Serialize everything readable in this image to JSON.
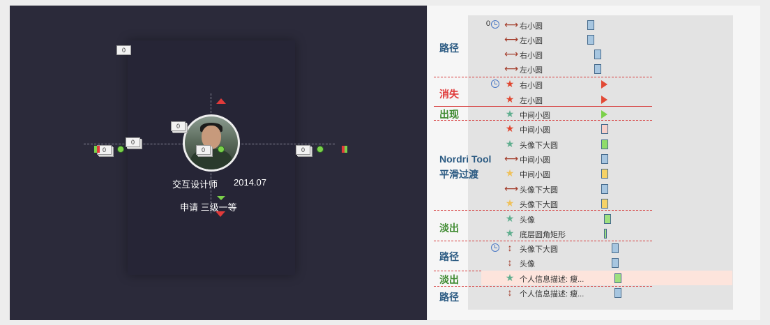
{
  "stage": {
    "name": "交互设计师",
    "date": "2014.07",
    "desc": "申请 三级一等",
    "tags": [
      "0",
      "0",
      "0",
      "0",
      "0",
      "0"
    ]
  },
  "timeline": {
    "groups": [
      {
        "label": "路径"
      },
      {
        "label": "消失"
      },
      {
        "label": "出现"
      },
      {
        "label": "Nordri Tool"
      },
      {
        "label": "平滑过渡"
      },
      {
        "label": "淡出"
      },
      {
        "label": "路径"
      },
      {
        "label": "淡出"
      },
      {
        "label": "路径"
      }
    ],
    "rows": [
      {
        "num": "0",
        "icon": "path-horizontal-icon",
        "label": "右小圆",
        "color": "#a7c6e0"
      },
      {
        "num": "",
        "icon": "path-horizontal-icon",
        "label": "左小圆",
        "color": "#a7c6e0"
      },
      {
        "num": "",
        "icon": "path-horizontal-icon",
        "label": "右小圆",
        "color": "#a7c6e0"
      },
      {
        "num": "",
        "icon": "path-horizontal-icon",
        "label": "左小圆",
        "color": "#a7c6e0"
      },
      {
        "num": "",
        "icon": "star-red-icon",
        "label": "右小圆",
        "color": "#e24a36"
      },
      {
        "num": "",
        "icon": "star-red-icon",
        "label": "左小圆",
        "color": "#e24a36"
      },
      {
        "num": "",
        "icon": "star-green-icon",
        "label": "中间小圆",
        "color": "#7bd14a"
      },
      {
        "num": "",
        "icon": "star-red-icon",
        "label": "中间小圆",
        "color": "#f7d0ca"
      },
      {
        "num": "",
        "icon": "star-green-icon",
        "label": "头像下大圆",
        "color": "#8fdc6a"
      },
      {
        "num": "",
        "icon": "path-horizontal-icon",
        "label": "中间小圆",
        "color": "#a7c6e0"
      },
      {
        "num": "",
        "icon": "star-yellow-icon",
        "label": "中间小圆",
        "color": "#f6d266"
      },
      {
        "num": "",
        "icon": "path-horizontal-icon",
        "label": "头像下大圆",
        "color": "#a7c6e0"
      },
      {
        "num": "",
        "icon": "star-yellow-icon",
        "label": "头像下大圆",
        "color": "#f6d266"
      },
      {
        "num": "",
        "icon": "star-green-icon",
        "label": "头像",
        "color": "#9ee07f"
      },
      {
        "num": "",
        "icon": "star-green-icon",
        "label": "底层圆角矩形",
        "color": "#9ee07f"
      },
      {
        "num": "",
        "icon": "path-vertical-icon",
        "label": "头像下大圆",
        "color": "#a7c6e0"
      },
      {
        "num": "",
        "icon": "path-vertical-icon",
        "label": "头像",
        "color": "#a7c6e0"
      },
      {
        "num": "",
        "icon": "star-green-icon",
        "label": "个人信息描述: 瘦...",
        "color": "#9ee07f"
      },
      {
        "num": "",
        "icon": "path-vertical-icon",
        "label": "个人信息描述: 瘦...",
        "color": "#a7c6e0"
      }
    ]
  }
}
